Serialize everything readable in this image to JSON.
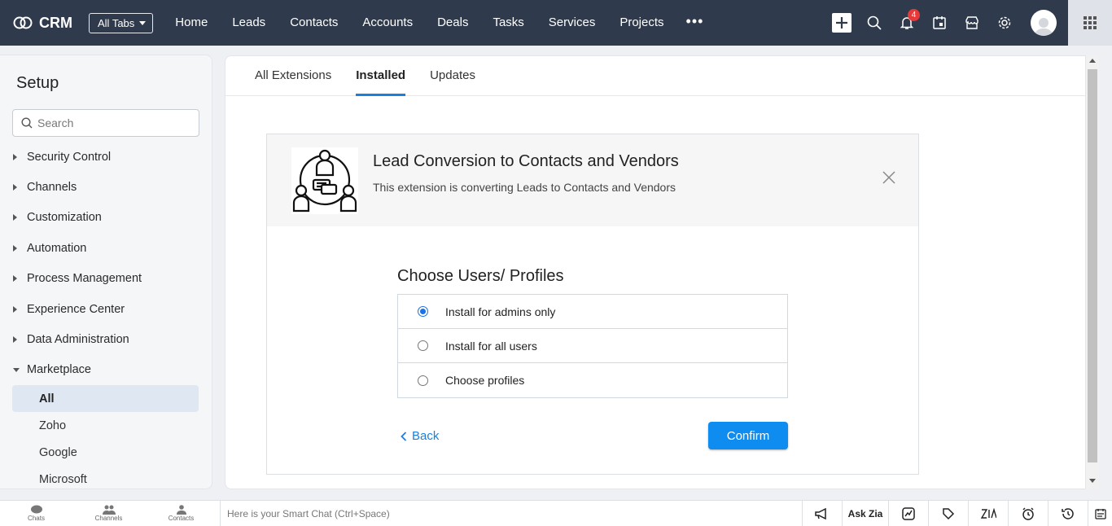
{
  "topbar": {
    "brand": "CRM",
    "all_tabs_label": "All Tabs",
    "tabs": [
      "Home",
      "Leads",
      "Contacts",
      "Accounts",
      "Deals",
      "Tasks",
      "Services",
      "Projects"
    ],
    "more": "•••",
    "notification_count": "4"
  },
  "sidebar": {
    "title": "Setup",
    "search_placeholder": "Search",
    "items": [
      {
        "label": "Security Control"
      },
      {
        "label": "Channels"
      },
      {
        "label": "Customization"
      },
      {
        "label": "Automation"
      },
      {
        "label": "Process Management"
      },
      {
        "label": "Experience Center"
      },
      {
        "label": "Data Administration"
      },
      {
        "label": "Marketplace"
      }
    ],
    "marketplace_sub": [
      {
        "label": "All",
        "active": true
      },
      {
        "label": "Zoho"
      },
      {
        "label": "Google"
      },
      {
        "label": "Microsoft"
      }
    ]
  },
  "main": {
    "tabs": [
      {
        "label": "All Extensions"
      },
      {
        "label": "Installed",
        "active": true
      },
      {
        "label": "Updates"
      }
    ],
    "extension": {
      "title": "Lead Conversion to Contacts and Vendors",
      "description": "This extension is converting Leads to Contacts and Vendors"
    },
    "choose_title": "Choose Users/ Profiles",
    "options": [
      {
        "label": "Install for admins only",
        "selected": true
      },
      {
        "label": "Install for all users",
        "selected": false
      },
      {
        "label": "Choose profiles",
        "selected": false
      }
    ],
    "back_label": "Back",
    "confirm_label": "Confirm"
  },
  "bottombar": {
    "items": [
      "Chats",
      "Channels",
      "Contacts"
    ],
    "smart_chat_placeholder": "Here is your Smart Chat (Ctrl+Space)",
    "ask_zia": "Ask Zia"
  },
  "colors": {
    "topbar_bg": "#2f3a4c",
    "accent": "#1a7fe0",
    "confirm_bg": "#0f8cf0",
    "badge": "#e63a3a"
  }
}
